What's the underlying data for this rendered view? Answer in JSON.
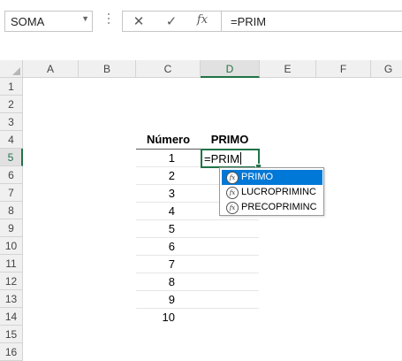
{
  "formula_bar": {
    "name_box": "SOMA",
    "cancel_symbol": "✕",
    "enter_symbol": "✓",
    "fx_symbol": "fx",
    "formula_text": "=PRIM"
  },
  "columns": [
    "A",
    "B",
    "C",
    "D",
    "E",
    "F",
    "G"
  ],
  "selected_column": "D",
  "rows": [
    "1",
    "2",
    "3",
    "4",
    "5",
    "6",
    "7",
    "8",
    "9",
    "10",
    "11",
    "12",
    "13",
    "14",
    "15",
    "16"
  ],
  "selected_row": "5",
  "table": {
    "header_numero": "Número",
    "header_primo": "PRIMO",
    "numbers": [
      "1",
      "2",
      "3",
      "4",
      "5",
      "6",
      "7",
      "8",
      "9",
      "10"
    ]
  },
  "active_cell": {
    "ref": "D5",
    "text": "=PRIM"
  },
  "autocomplete": {
    "items": [
      "PRIMO",
      "LUCROPRIMINC",
      "PRECOPRIMINC"
    ],
    "highlighted_index": 0
  },
  "colors": {
    "accent_green": "#217346",
    "highlight_blue": "#0078d7"
  }
}
